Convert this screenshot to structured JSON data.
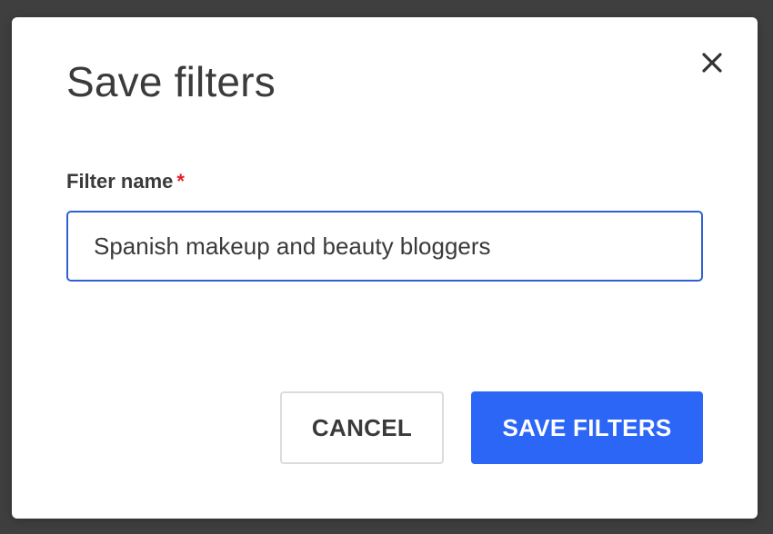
{
  "dialog": {
    "title": "Save filters",
    "close_icon": "close-icon",
    "field": {
      "label": "Filter name",
      "required_mark": "*",
      "value": "Spanish makeup and beauty bloggers"
    },
    "buttons": {
      "cancel_label": "CANCEL",
      "save_label": "SAVE FILTERS"
    }
  },
  "colors": {
    "backdrop": "#3f3f3f",
    "accent": "#2b66f6",
    "input_border": "#2f5fd0",
    "required": "#e11d2a"
  }
}
